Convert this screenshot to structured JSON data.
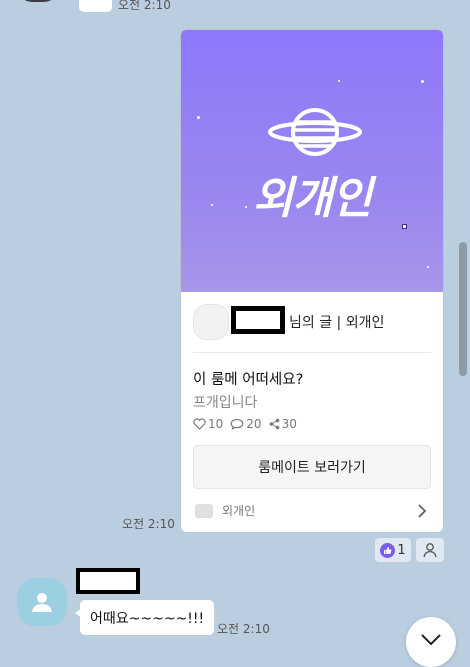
{
  "top_row": {
    "time": "오전 2:10"
  },
  "card": {
    "banner_title": "외개인",
    "source_suffix": "님의 글 | 외개인",
    "post_title": "이 룸메 어떠세요?",
    "post_subtitle": "프개입니다",
    "stats": {
      "likes": "10",
      "comments": "20",
      "shares": "30"
    },
    "cta_label": "룸메이트 보러가기",
    "footer_name": "외개인"
  },
  "card_time": "오전 2:10",
  "reaction": {
    "count": "1"
  },
  "incoming": {
    "message": "어때요~~~~~!!!",
    "time": "오전 2:10"
  },
  "colors": {
    "background": "#bacee0",
    "banner": "#8d78fb",
    "reaction_accent": "#7b5cf2"
  }
}
